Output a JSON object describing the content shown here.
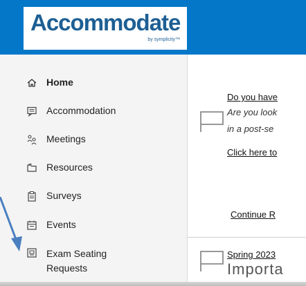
{
  "brand": {
    "logo_text": "Accommodate",
    "logo_sub": "by symplicity™",
    "header_color": "#0477c9",
    "logo_color": "#1d5f94"
  },
  "sidebar": {
    "items": [
      {
        "label": "Home",
        "icon": "home-icon",
        "active": true
      },
      {
        "label": "Accommodation",
        "icon": "message-icon"
      },
      {
        "label": "Meetings",
        "icon": "people-icon"
      },
      {
        "label": "Resources",
        "icon": "folder-icon"
      },
      {
        "label": "Surveys",
        "icon": "clipboard-icon"
      },
      {
        "label": "Events",
        "icon": "calendar-icon"
      },
      {
        "label": "Exam Seating Requests",
        "label_line1": "Exam Seating",
        "label_line2": "Requests",
        "icon": "exam-seat-icon"
      }
    ]
  },
  "main": {
    "card1": {
      "title": "Do you have",
      "line1": "Are you look",
      "line2": "in a post-se",
      "link": "Click here to",
      "continue": "Continue R"
    },
    "card2": {
      "title": "Spring 2023",
      "headline": "Importa"
    }
  },
  "annotation": {
    "arrow_color": "#4a7fc0"
  }
}
